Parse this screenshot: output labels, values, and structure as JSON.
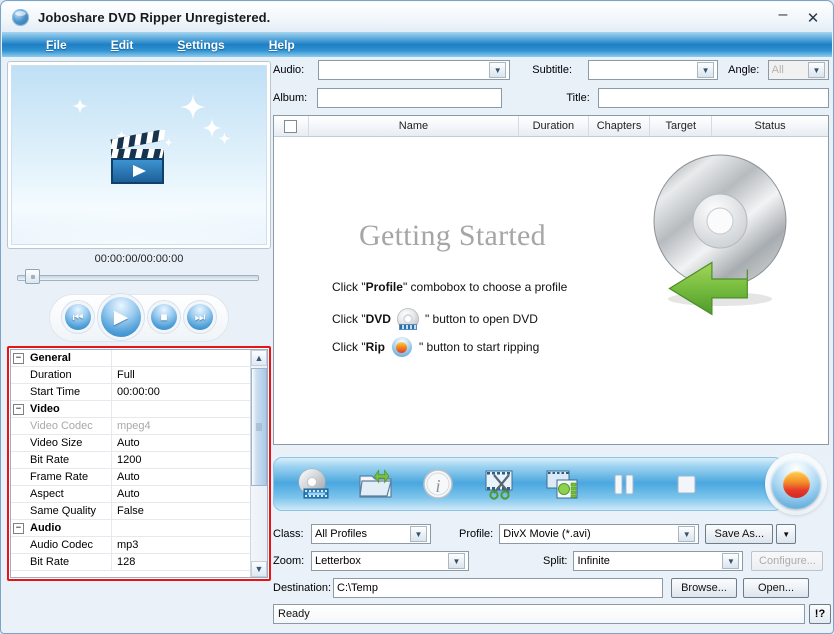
{
  "window": {
    "title": "Joboshare DVD Ripper Unregistered.",
    "app_icon": "app-disc-icon",
    "minimize": "–",
    "close": "✕"
  },
  "menubar": [
    {
      "pre": "",
      "mn": "F",
      "post": "ile"
    },
    {
      "pre": "",
      "mn": "E",
      "post": "dit"
    },
    {
      "pre": "",
      "mn": "S",
      "post": "ettings"
    },
    {
      "pre": "",
      "mn": "H",
      "post": "elp"
    }
  ],
  "preview": {
    "timecode": "00:00:00/00:00:00",
    "transport": {
      "previous": "⏮",
      "play": "▶",
      "stop": "■",
      "next": "⏭"
    }
  },
  "properties": {
    "rows": [
      {
        "type": "group",
        "name": "General",
        "value": "",
        "disabled": false
      },
      {
        "type": "item",
        "name": "Duration",
        "value": "Full",
        "disabled": false
      },
      {
        "type": "item",
        "name": "Start Time",
        "value": "00:00:00",
        "disabled": false
      },
      {
        "type": "group",
        "name": "Video",
        "value": "",
        "disabled": false
      },
      {
        "type": "item",
        "name": "Video Codec",
        "value": "mpeg4",
        "disabled": true
      },
      {
        "type": "item",
        "name": "Video Size",
        "value": "Auto",
        "disabled": false
      },
      {
        "type": "item",
        "name": "Bit Rate",
        "value": "1200",
        "disabled": false
      },
      {
        "type": "item",
        "name": "Frame Rate",
        "value": "Auto",
        "disabled": false
      },
      {
        "type": "item",
        "name": "Aspect",
        "value": "Auto",
        "disabled": false
      },
      {
        "type": "item",
        "name": "Same Quality",
        "value": "False",
        "disabled": false
      },
      {
        "type": "group",
        "name": "Audio",
        "value": "",
        "disabled": false
      },
      {
        "type": "item",
        "name": "Audio Codec",
        "value": "mp3",
        "disabled": false
      },
      {
        "type": "item",
        "name": "Bit Rate",
        "value": "128",
        "disabled": false
      }
    ],
    "scroll_up": "▲",
    "scroll_down": "▼"
  },
  "fields": {
    "audio_label": "Audio:",
    "audio_value": "",
    "subtitle_label": "Subtitle:",
    "subtitle_value": "",
    "angle_label": "Angle:",
    "angle_value": "All",
    "album_label": "Album:",
    "album_value": "",
    "title_label": "Title:",
    "title_value": ""
  },
  "filelist": {
    "columns": [
      "Name",
      "Duration",
      "Chapters",
      "Target",
      "Status"
    ]
  },
  "getting_started": {
    "heading": "Getting Started",
    "line1_a": "Click \"",
    "line1_b": "Profile",
    "line1_c": "\" combobox to choose a profile",
    "line2_a": "Click \"",
    "line2_b": "DVD",
    "line2_c": "\" button to open DVD",
    "line3_a": "Click \"",
    "line3_b": "Rip",
    "line3_c": "\" button to start ripping"
  },
  "toolbar": {
    "buttons": [
      {
        "name": "open-dvd-icon",
        "tip": "Open DVD"
      },
      {
        "name": "open-folder-icon",
        "tip": "Open File"
      },
      {
        "name": "info-icon",
        "tip": "Information"
      },
      {
        "name": "clip-icon",
        "tip": "Clip"
      },
      {
        "name": "effect-icon",
        "tip": "Effect"
      },
      {
        "name": "pause-icon",
        "tip": "Pause"
      },
      {
        "name": "stop-icon",
        "tip": "Stop"
      }
    ],
    "rip_label": "Rip"
  },
  "settings": {
    "class_label": "Class:",
    "class_value": "All Profiles",
    "profile_label": "Profile:",
    "profile_value": "DivX Movie  (*.avi)",
    "save_as_label": "Save As...",
    "save_as_arrow": "▼",
    "zoom_label": "Zoom:",
    "zoom_value": "Letterbox",
    "split_label": "Split:",
    "split_value": "Infinite",
    "configure_label": "Configure...",
    "destination_label": "Destination:",
    "destination_value": "C:\\Temp",
    "browse_label": "Browse...",
    "open_label": "Open..."
  },
  "statusbar": {
    "text": "Ready",
    "help_label": "!?"
  },
  "colors": {
    "accent_blue": "#1f7fc4",
    "highlight_red": "#e81313",
    "rip_red": "#e5392b",
    "disc_green": "#7ac143"
  }
}
